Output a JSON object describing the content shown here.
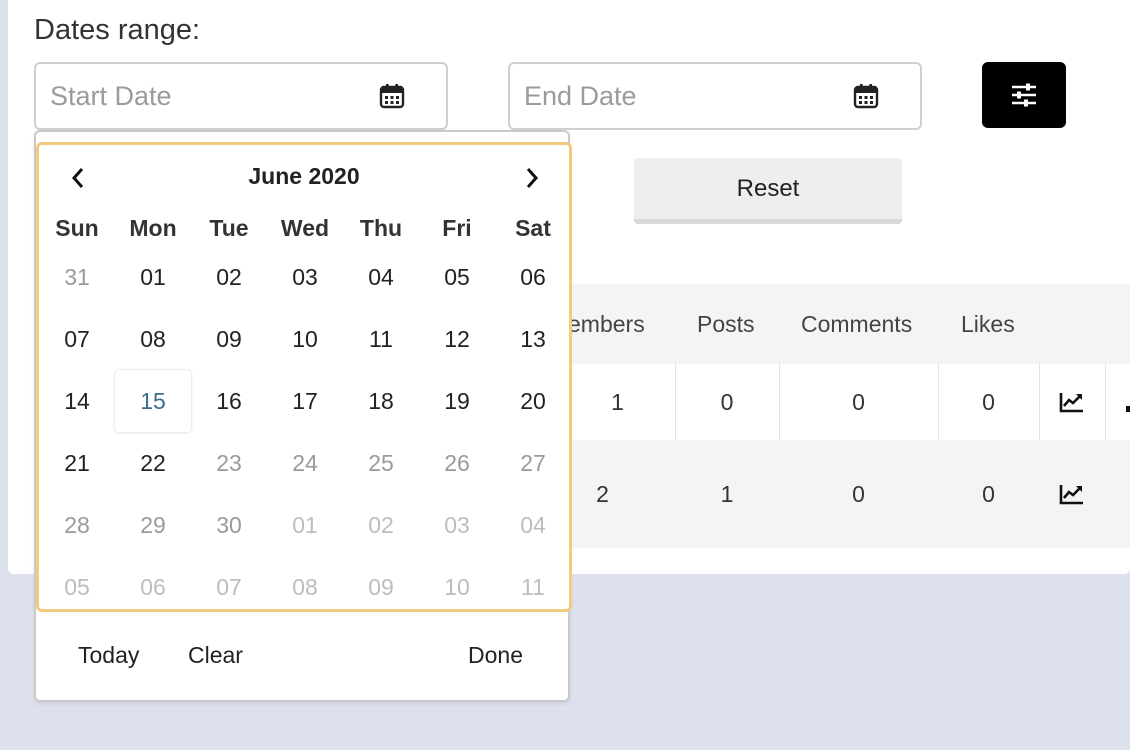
{
  "filters": {
    "range_label": "Dates range:",
    "start_placeholder": "Start Date",
    "end_placeholder": "End Date",
    "reset_label": "Reset",
    "filter_icon": "sliders-icon",
    "calendar_icon": "calendar-icon"
  },
  "table": {
    "headers": [
      "embers",
      "Posts",
      "Comments",
      "Likes"
    ],
    "rows": [
      {
        "members": "1",
        "posts": "0",
        "comments": "0",
        "likes": "0",
        "action_icon": "trend-chart-icon"
      },
      {
        "members": "2",
        "posts": "1",
        "comments": "0",
        "likes": "0",
        "action_icon": "trend-chart-icon"
      }
    ]
  },
  "datepicker": {
    "month_title": "June 2020",
    "weekdays": [
      "Sun",
      "Mon",
      "Tue",
      "Wed",
      "Thu",
      "Fri",
      "Sat"
    ],
    "weeks": [
      [
        "31",
        "01",
        "02",
        "03",
        "04",
        "05",
        "06"
      ],
      [
        "07",
        "08",
        "09",
        "10",
        "11",
        "12",
        "13"
      ],
      [
        "14",
        "15",
        "16",
        "17",
        "18",
        "19",
        "20"
      ],
      [
        "21",
        "22",
        "23",
        "24",
        "25",
        "26",
        "27"
      ],
      [
        "28",
        "29",
        "30",
        "01",
        "02",
        "03",
        "04"
      ],
      [
        "05",
        "06",
        "07",
        "08",
        "09",
        "10",
        "11"
      ]
    ],
    "today_label": "Today",
    "clear_label": "Clear",
    "done_label": "Done",
    "highlighted_day": "15"
  },
  "colors": {
    "accent_border": "#f2cb7e",
    "today_text": "#3b6e8a",
    "page_background": "#dde1ec"
  }
}
